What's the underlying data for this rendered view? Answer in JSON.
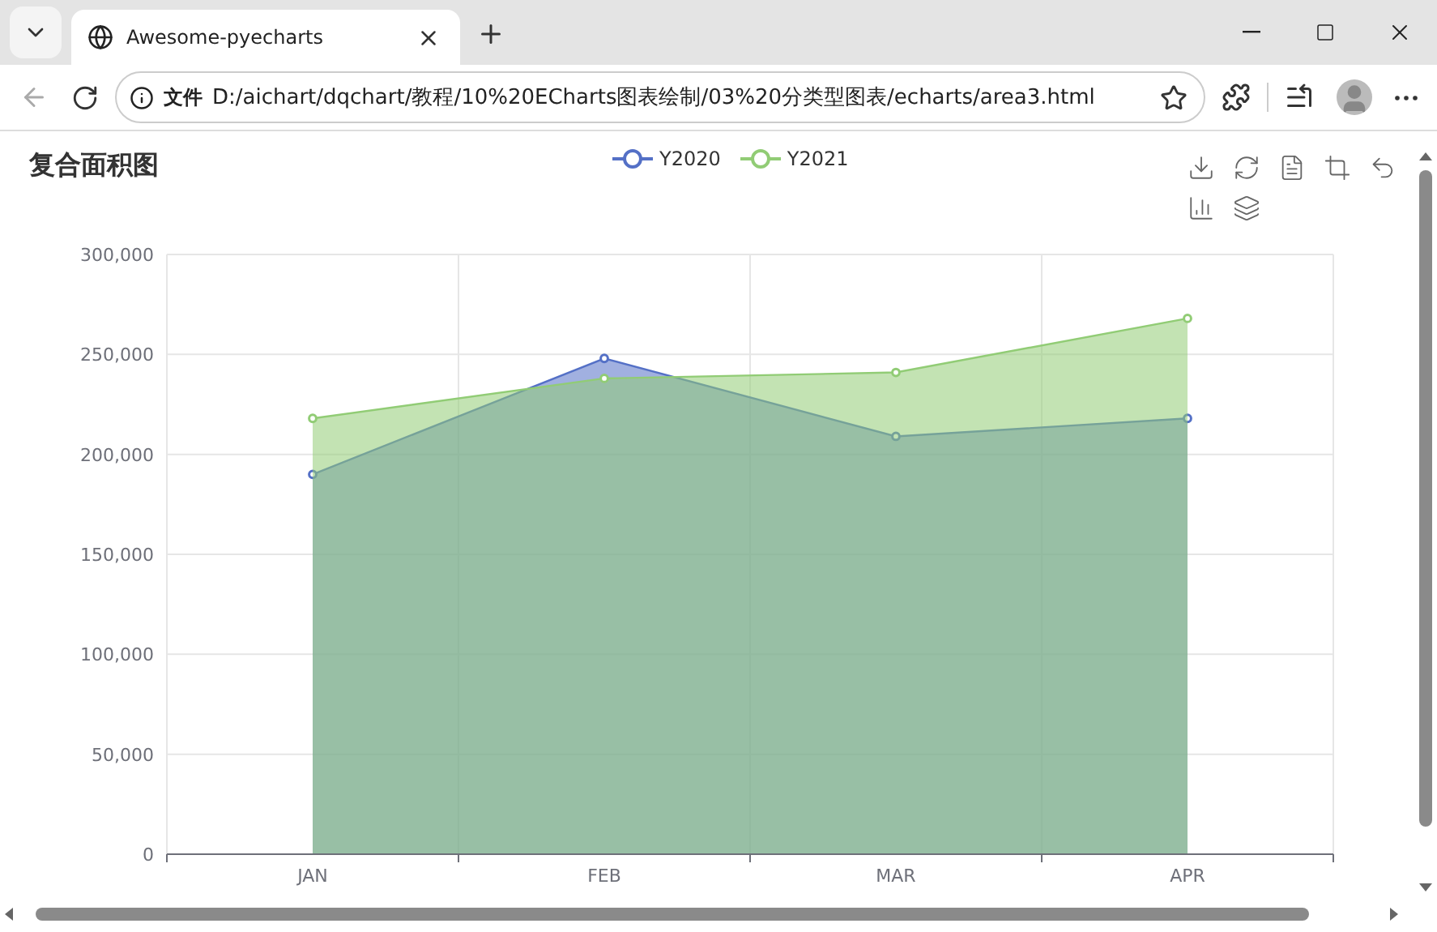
{
  "browser": {
    "tab_title": "Awesome-pyecharts",
    "address_label": "文件",
    "url": "D:/aichart/dqchart/教程/10%20ECharts图表绘制/03%20分类型图表/echarts/area3.html"
  },
  "chart_title": "复合面积图",
  "chart_data": {
    "type": "area",
    "categories": [
      "JAN",
      "FEB",
      "MAR",
      "APR"
    ],
    "series": [
      {
        "name": "Y2020",
        "color": "#5470c6",
        "values": [
          190000,
          248000,
          209000,
          218000
        ]
      },
      {
        "name": "Y2021",
        "color": "#91cc75",
        "values": [
          218000,
          238000,
          241000,
          268000
        ]
      }
    ],
    "ylim": [
      0,
      300000
    ],
    "yticks": [
      {
        "value": 0,
        "label": "0"
      },
      {
        "value": 50000,
        "label": "50,000"
      },
      {
        "value": 100000,
        "label": "100,000"
      },
      {
        "value": 150000,
        "label": "150,000"
      },
      {
        "value": 200000,
        "label": "200,000"
      },
      {
        "value": 250000,
        "label": "250,000"
      },
      {
        "value": 300000,
        "label": "300,000"
      }
    ],
    "grid": true
  }
}
